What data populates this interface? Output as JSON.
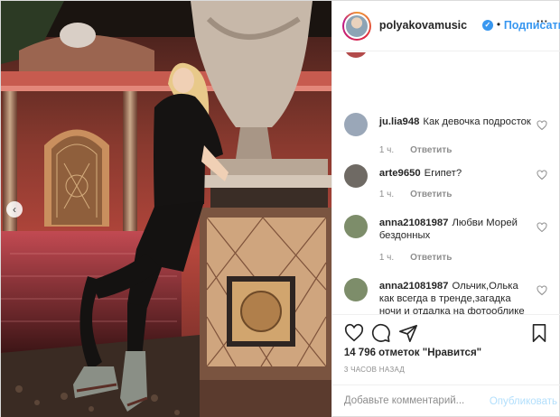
{
  "post": {
    "username": "polyakovamusic",
    "separator": "•",
    "follow_label": "Подписаться",
    "more_label": "···",
    "carousel_prev": "‹"
  },
  "comments": [
    {
      "user": "ju.lia948",
      "text": "Как девочка подросток",
      "time": "1 ч.",
      "reply": "Ответить",
      "avatar_color": "#9aa7b8"
    },
    {
      "user": "arte9650",
      "text": "Египет?",
      "time": "1 ч.",
      "reply": "Ответить",
      "avatar_color": "#6f6a64"
    },
    {
      "user": "anna21081987",
      "text": "Любви Морей бездонных",
      "time": "1 ч.",
      "reply": "Ответить",
      "avatar_color": "#7d8d6a"
    },
    {
      "user": "anna21081987",
      "text": "Ольчик,Олька как всегда в тренде,загадка ночи и отдалка на фотооблике",
      "time": "",
      "reply": "",
      "avatar_color": "#7d8d6a"
    }
  ],
  "likes_text": "14 796 отметок \"Нравится\"",
  "time_ago": "3 ЧАСОВ НАЗАД",
  "comment_input": {
    "placeholder": "Добавьте комментарий...",
    "value": ""
  },
  "publish_label": "Опубликовать",
  "icons": [
    "heart-icon",
    "comment-icon",
    "share-icon",
    "bookmark-icon",
    "verified-icon"
  ],
  "colors": {
    "accent": "#3897f0",
    "publish_disabled": "#b2dffc",
    "text": "#262626",
    "muted": "#8e8e8e"
  }
}
